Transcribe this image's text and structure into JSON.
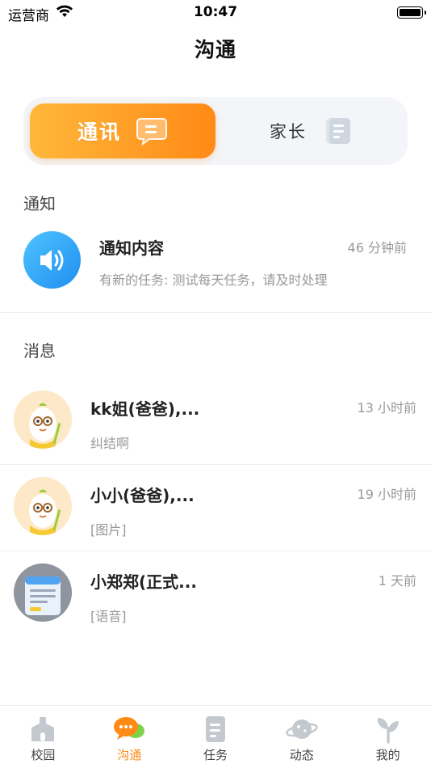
{
  "status_bar": {
    "carrier": "运营商",
    "time": "10:47"
  },
  "header": {
    "title": "沟通"
  },
  "segment": {
    "tabs": [
      {
        "label": "通讯",
        "active": true
      },
      {
        "label": "家长",
        "active": false
      }
    ]
  },
  "notice_section": {
    "label": "通知",
    "item": {
      "title": "通知内容",
      "time": "46 分钟前",
      "subtitle": "有新的任务: 测试每天任务，请及时处理",
      "icon": "speaker-icon"
    }
  },
  "message_section": {
    "label": "消息",
    "items": [
      {
        "name": "kk姐(爸爸),...",
        "time": "13 小时前",
        "preview": "纠结啊"
      },
      {
        "name": "小小(爸爸),...",
        "time": "19 小时前",
        "preview": "[图片]"
      },
      {
        "name": "小郑郑(正式...",
        "time": "1 天前",
        "preview": "[语音]"
      }
    ]
  },
  "tabbar": {
    "items": [
      {
        "label": "校园",
        "icon": "school-icon",
        "active": false
      },
      {
        "label": "沟通",
        "icon": "chat-bubbles-icon",
        "active": true
      },
      {
        "label": "任务",
        "icon": "task-icon",
        "active": false
      },
      {
        "label": "动态",
        "icon": "planet-icon",
        "active": false
      },
      {
        "label": "我的",
        "icon": "sprout-icon",
        "active": false
      }
    ]
  },
  "colors": {
    "accent": "#ff8a16",
    "accent_light": "#ffb73a",
    "inactive_icon": "#c4c8cf",
    "notice_blue": "#1f8ef0"
  }
}
